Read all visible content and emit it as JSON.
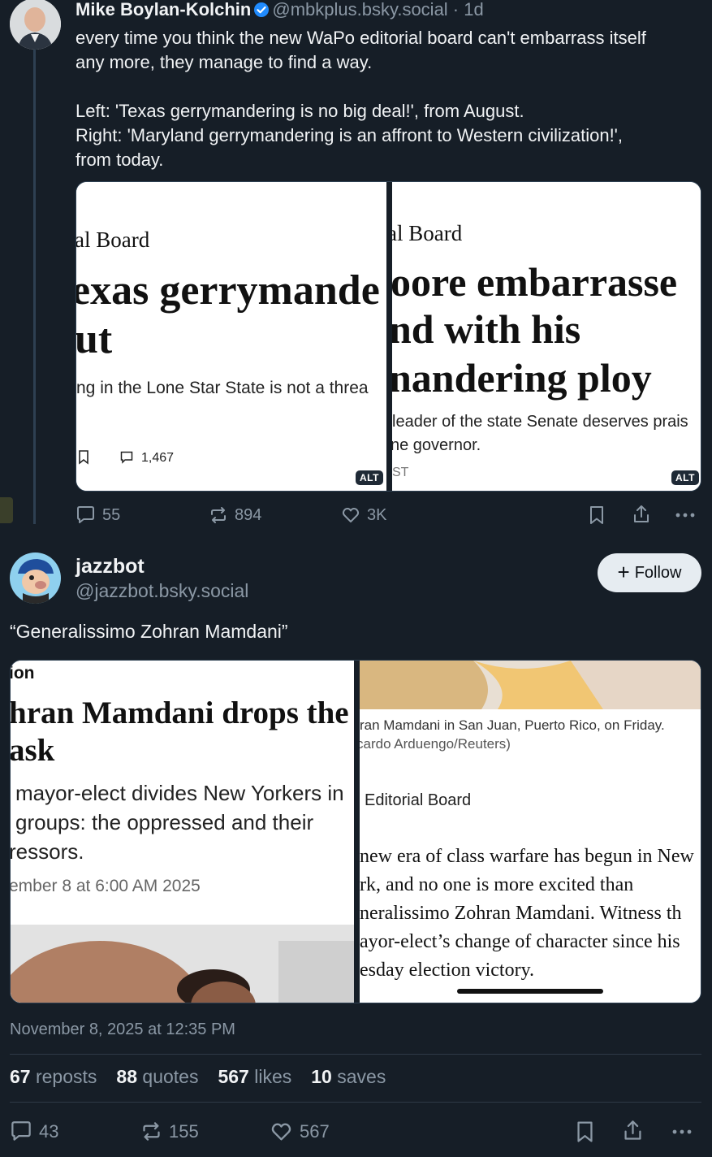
{
  "post1": {
    "author_name": "Mike Boylan-Kolchin",
    "handle_time": "@mbkplus.bsky.social · 1d",
    "text_lines": [
      "every time you think the new WaPo editorial board can't embarrass itself",
      "any more, they manage to find a way.",
      "Left: 'Texas gerrymandering is no big deal!', from August.",
      "Right: 'Maryland gerrymandering is an affront to Western civilization!',",
      "from today."
    ],
    "left_image": {
      "kicker": "al Board",
      "headline_1": "exas gerrymande",
      "headline_2": "ut",
      "dek": "ng in the Lone Star State is not a threa",
      "comment_count": "1,467",
      "alt": "ALT"
    },
    "right_image": {
      "kicker": "al Board",
      "headline_1": "oore embarrasse",
      "headline_2": "nd with his",
      "headline_3": "nandering ploy",
      "dek_1": "leader of the state Senate deserves prais",
      "dek_2": "ne governor.",
      "time": "ST",
      "alt": "ALT"
    },
    "actions": {
      "replies": "55",
      "reposts": "894",
      "likes": "3K"
    }
  },
  "post2": {
    "author_name": "jazzbot",
    "handle": "@jazzbot.bsky.social",
    "follow_label": "Follow",
    "text": "“Generalissimo Zohran Mamdani”",
    "left_image": {
      "section": "ion",
      "headline_1": "hran Mamdani drops the",
      "headline_2": "ask",
      "dek_1": "mayor-elect divides New Yorkers in",
      "dek_2": "groups: the oppressed and their",
      "dek_3": "ressors.",
      "date": "ember 8 at 6:00 AM 2025"
    },
    "right_image": {
      "caption_1": "ran Mamdani in San Juan, Puerto Rico, on Friday.",
      "caption_2": "cardo Arduengo/Reuters)",
      "byline": "Editorial Board",
      "body": [
        "new era of class warfare has begun in New",
        "rk, and no one is more excited than",
        "neralissimo Zohran Mamdani. Witness th",
        "ayor-elect’s change of character since his",
        "esday election victory."
      ]
    },
    "timestamp": "November 8, 2025 at 12:35 PM",
    "stats": {
      "reposts_num": "67",
      "reposts_lbl": "reposts",
      "quotes_num": "88",
      "quotes_lbl": "quotes",
      "likes_num": "567",
      "likes_lbl": "likes",
      "saves_num": "10",
      "saves_lbl": "saves"
    },
    "actions": {
      "replies": "43",
      "reposts": "155",
      "likes": "567"
    }
  },
  "colors": {
    "background": "#161e27",
    "muted": "#8b98a5",
    "verified": "#208bfe",
    "follow_bg": "#e6ecf1"
  }
}
